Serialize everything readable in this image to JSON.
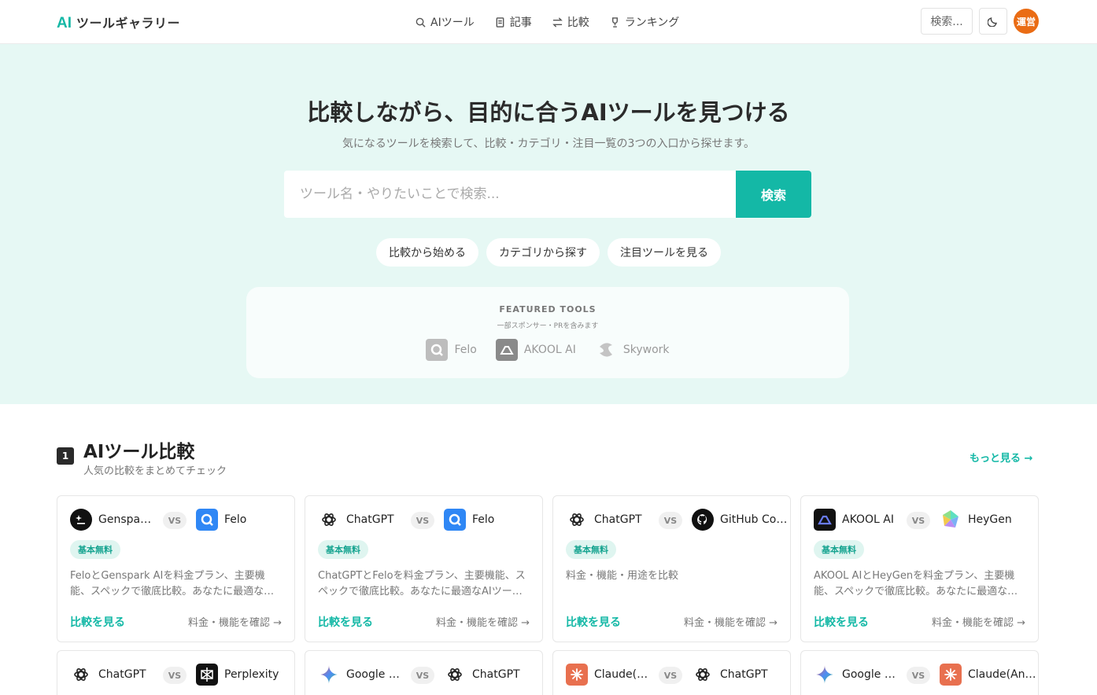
{
  "header": {
    "logo_ai": "AI",
    "logo_text": "ツールギャラリー",
    "nav": [
      {
        "label": "AIツール",
        "icon": "search-icon"
      },
      {
        "label": "記事",
        "icon": "document-icon"
      },
      {
        "label": "比較",
        "icon": "swap-icon"
      },
      {
        "label": "ランキング",
        "icon": "trophy-icon"
      }
    ],
    "search_label": "検索...",
    "avatar_label": "運営"
  },
  "hero": {
    "title": "比較しながら、目的に合うAIツールを見つける",
    "subtitle": "気になるツールを検索して、比較・カテゴリ・注目一覧の3つの入口から探せます。",
    "search_placeholder": "ツール名・やりたいことで検索...",
    "search_button": "検索",
    "pills": [
      "比較から始める",
      "カテゴリから探す",
      "注目ツールを見る"
    ],
    "featured": {
      "label": "FEATURED TOOLS",
      "note": "一部スポンサー・PRを含みます",
      "tools": [
        "Felo",
        "AKOOL AI",
        "Skywork"
      ]
    }
  },
  "section": {
    "number": "1",
    "title": "AIツール比較",
    "subtitle": "人気の比較をまとめてチェック",
    "more": "もっと見る →"
  },
  "cards": [
    {
      "a": "Genspark AI",
      "b": "Felo",
      "badge": "基本無料",
      "desc": "FeloとGenspark AIを料金プラン、主要機能、スペックで徹底比較。あなたに最適なツールを見つけましょう。",
      "compare": "比較を見る",
      "check": "料金・機能を確認 →"
    },
    {
      "a": "ChatGPT",
      "b": "Felo",
      "badge": "基本無料",
      "desc": "ChatGPTとFeloを料金プラン、主要機能、スペックで徹底比較。あなたに最適なAIツールを見つけましょう。",
      "compare": "比較を見る",
      "check": "料金・機能を確認 →"
    },
    {
      "a": "ChatGPT",
      "b": "GitHub Copilot",
      "badge": "基本無料",
      "desc": "料金・機能・用途を比較",
      "compare": "比較を見る",
      "check": "料金・機能を確認 →"
    },
    {
      "a": "AKOOL AI",
      "b": "HeyGen",
      "badge": "基本無料",
      "desc": "AKOOL AIとHeyGenを料金プラン、主要機能、スペックで徹底比較。あなたに最適なツールを見つけましょう。",
      "compare": "比較を見る",
      "check": "料金・機能を確認 →"
    },
    {
      "a": "ChatGPT",
      "b": "Perplexity"
    },
    {
      "a": "Google Gemini",
      "b": "ChatGPT"
    },
    {
      "a": "Claude(Anthropic)",
      "b": "ChatGPT"
    },
    {
      "a": "Google Gemini",
      "b": "Claude(Anthropic)"
    }
  ],
  "vs_label": "VS",
  "colors": {
    "accent": "#14b8a6",
    "hero_bg": "#e6f8f4",
    "avatar": "#ea6c14"
  }
}
